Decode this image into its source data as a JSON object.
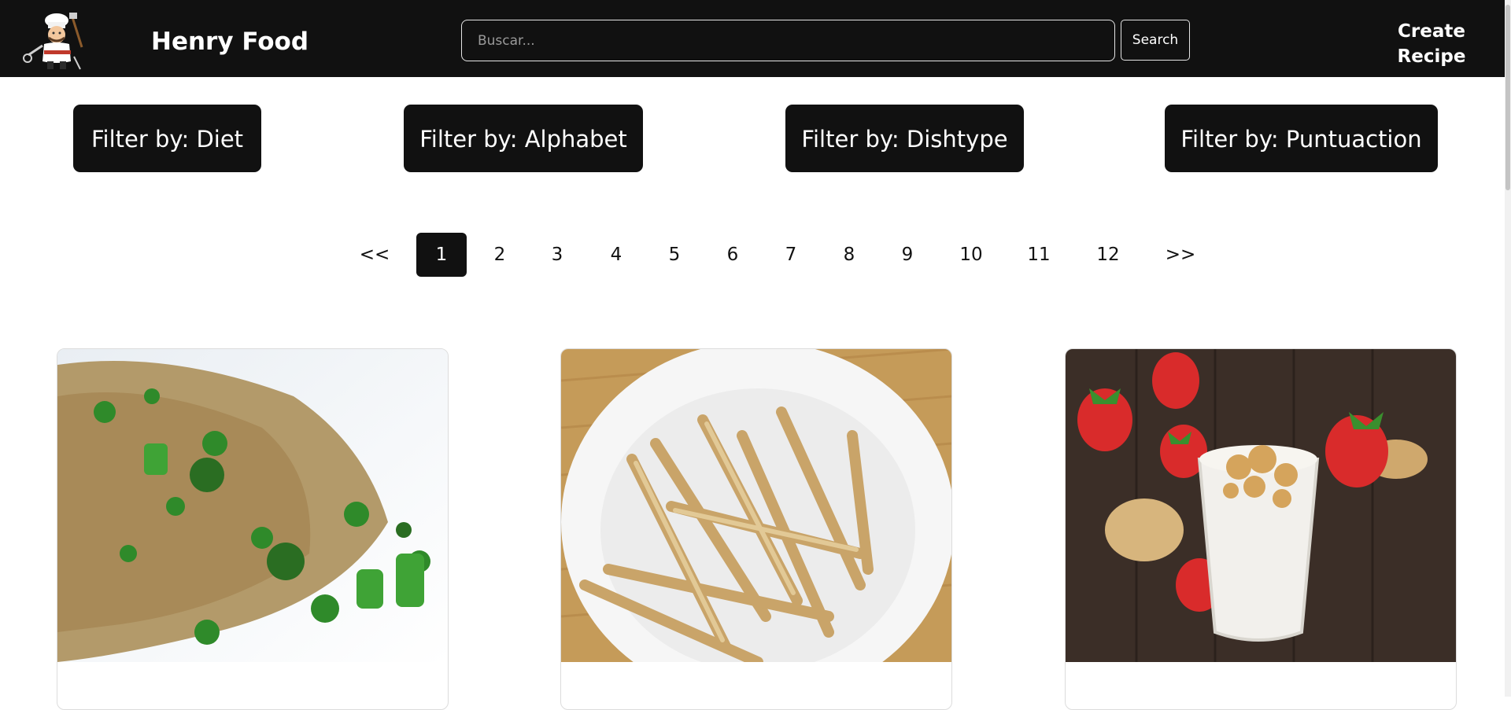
{
  "navbar": {
    "brand": "Henry Food",
    "search_placeholder": "Buscar...",
    "search_button": "Search",
    "create_recipe": "Create Recipe",
    "logo_icon": "chef-logo-icon"
  },
  "filters": [
    {
      "label": "Filter by: Diet"
    },
    {
      "label": "Filter by: Alphabet"
    },
    {
      "label": "Filter by: Dishtype"
    },
    {
      "label": "Filter by: Puntuaction"
    }
  ],
  "pagination": {
    "prev": "<<",
    "next": ">>",
    "current_page": 1,
    "pages": [
      "1",
      "2",
      "3",
      "4",
      "5",
      "6",
      "7",
      "8",
      "9",
      "10",
      "11",
      "12"
    ]
  },
  "recipes": [
    {
      "image_icon": "fried-rice-with-broccoli-and-peas-photo"
    },
    {
      "image_icon": "baked-potato-fries-photo"
    },
    {
      "image_icon": "strawberry-smoothie-photo"
    }
  ],
  "colors": {
    "primary": "#111111",
    "background": "#ffffff",
    "text_light": "#ffffff"
  }
}
